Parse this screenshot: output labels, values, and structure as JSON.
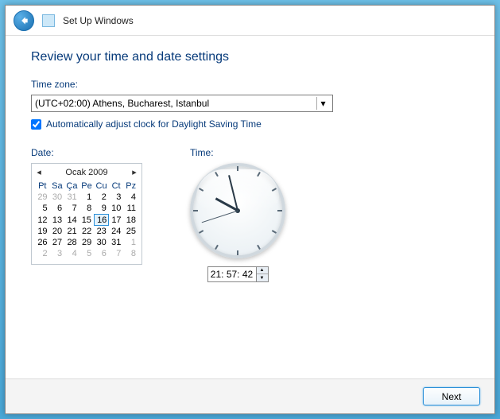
{
  "window": {
    "title": "Set Up Windows"
  },
  "heading": "Review your time and date settings",
  "timezone": {
    "label": "Time zone:",
    "selected": "(UTC+02:00) Athens, Bucharest, Istanbul"
  },
  "dst": {
    "checked": true,
    "label": "Automatically adjust clock for Daylight Saving Time"
  },
  "date": {
    "label": "Date:",
    "month_title": "Ocak 2009",
    "weekdays": [
      "Pt",
      "Sa",
      "Ça",
      "Pe",
      "Cu",
      "Ct",
      "Pz"
    ],
    "cells": [
      {
        "v": "29",
        "dim": true
      },
      {
        "v": "30",
        "dim": true
      },
      {
        "v": "31",
        "dim": true
      },
      {
        "v": "1"
      },
      {
        "v": "2"
      },
      {
        "v": "3"
      },
      {
        "v": "4"
      },
      {
        "v": "5"
      },
      {
        "v": "6"
      },
      {
        "v": "7"
      },
      {
        "v": "8"
      },
      {
        "v": "9"
      },
      {
        "v": "10"
      },
      {
        "v": "11"
      },
      {
        "v": "12"
      },
      {
        "v": "13"
      },
      {
        "v": "14"
      },
      {
        "v": "15"
      },
      {
        "v": "16",
        "sel": true
      },
      {
        "v": "17"
      },
      {
        "v": "18"
      },
      {
        "v": "19"
      },
      {
        "v": "20"
      },
      {
        "v": "21"
      },
      {
        "v": "22"
      },
      {
        "v": "23"
      },
      {
        "v": "24"
      },
      {
        "v": "25"
      },
      {
        "v": "26"
      },
      {
        "v": "27"
      },
      {
        "v": "28"
      },
      {
        "v": "29"
      },
      {
        "v": "30"
      },
      {
        "v": "31"
      },
      {
        "v": "1",
        "dim": true
      },
      {
        "v": "2",
        "dim": true
      },
      {
        "v": "3",
        "dim": true
      },
      {
        "v": "4",
        "dim": true
      },
      {
        "v": "5",
        "dim": true
      },
      {
        "v": "6",
        "dim": true
      },
      {
        "v": "7",
        "dim": true
      },
      {
        "v": "8",
        "dim": true
      }
    ]
  },
  "time": {
    "label": "Time:",
    "value": "21: 57: 42",
    "hour": 21,
    "minute": 57,
    "second": 42
  },
  "footer": {
    "next": "Next"
  }
}
